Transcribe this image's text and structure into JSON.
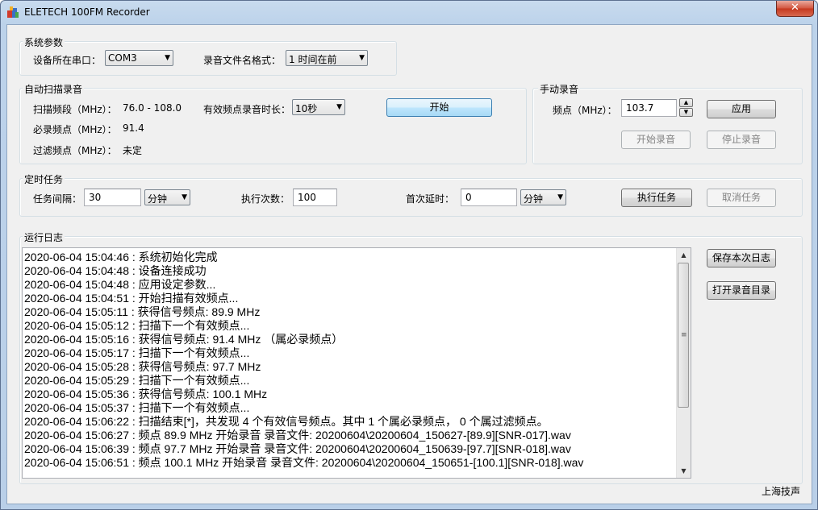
{
  "window": {
    "title": "ELETECH 100FM Recorder",
    "close_glyph": "✕"
  },
  "system_params": {
    "group_label": "系统参数",
    "port_label": "设备所在串口：",
    "port_value": "COM3",
    "filename_label": "录音文件名格式：",
    "filename_value": "1 时间在前"
  },
  "auto_scan": {
    "group_label": "自动扫描录音",
    "scan_band_label": "扫描频段（MHz）：",
    "scan_band_value": "76.0 - 108.0",
    "required_label": "必录频点（MHz）：",
    "required_value": "91.4",
    "filter_label": "过滤频点（MHz）：",
    "filter_value": "未定",
    "duration_label": "有效频点录音时长：",
    "duration_value": "10秒",
    "start_button": "开始"
  },
  "manual": {
    "group_label": "手动录音",
    "freq_label": "频点（MHz）：",
    "freq_value": "103.7",
    "apply_button": "应用",
    "start_record_button": "开始录音",
    "stop_record_button": "停止录音"
  },
  "scheduled": {
    "group_label": "定时任务",
    "interval_label": "任务间隔：",
    "interval_value": "30",
    "interval_unit": "分钟",
    "count_label": "执行次数：",
    "count_value": "100",
    "delay_label": "首次延时：",
    "delay_value": "0",
    "delay_unit": "分钟",
    "execute_button": "执行任务",
    "cancel_button": "取消任务"
  },
  "log": {
    "group_label": "运行日志",
    "save_button": "保存本次日志",
    "open_dir_button": "打开录音目录",
    "lines": [
      "2020-06-04 15:04:46 : 系统初始化完成",
      "2020-06-04 15:04:48 : 设备连接成功",
      "2020-06-04 15:04:48 : 应用设定参数...",
      "2020-06-04 15:04:51 : 开始扫描有效频点...",
      "2020-06-04 15:05:11 : 获得信号频点: 89.9 MHz",
      "2020-06-04 15:05:12 : 扫描下一个有效频点...",
      "2020-06-04 15:05:16 : 获得信号频点: 91.4 MHz （属必录频点）",
      "2020-06-04 15:05:17 : 扫描下一个有效频点...",
      "2020-06-04 15:05:28 : 获得信号频点: 97.7 MHz",
      "2020-06-04 15:05:29 : 扫描下一个有效频点...",
      "2020-06-04 15:05:36 : 获得信号频点: 100.1 MHz",
      "2020-06-04 15:05:37 : 扫描下一个有效频点...",
      "2020-06-04 15:06:22 : 扫描结束[*]，共发现 4 个有效信号频点。其中 1 个属必录频点， 0 个属过滤频点。",
      "2020-06-04 15:06:27 : 频点 89.9 MHz 开始录音 录音文件: 20200604\\20200604_150627-[89.9][SNR-017].wav",
      "2020-06-04 15:06:39 : 频点 97.7 MHz 开始录音 录音文件: 20200604\\20200604_150639-[97.7][SNR-018].wav",
      "2020-06-04 15:06:51 : 频点 100.1 MHz 开始录音 录音文件: 20200604\\20200604_150651-[100.1][SNR-018].wav"
    ]
  },
  "status": {
    "company": "上海技声"
  }
}
